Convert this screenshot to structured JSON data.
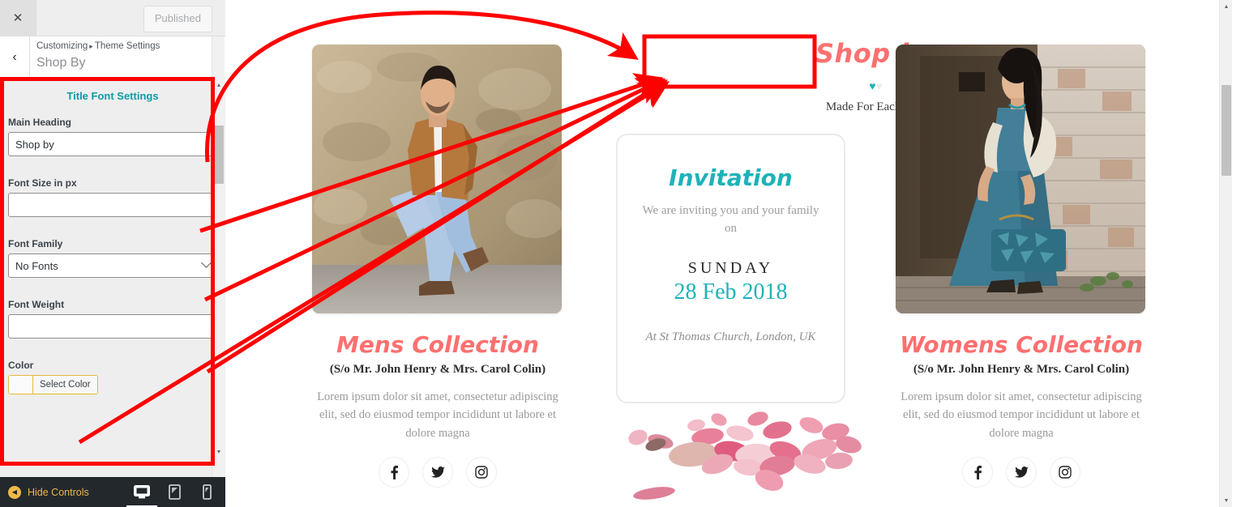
{
  "customizer": {
    "close_icon": "✕",
    "back_icon": "‹",
    "publish_button": "Published",
    "breadcrumb_root": "Customizing",
    "breadcrumb_sep": "▸",
    "breadcrumb_section": "Theme Settings",
    "panel_title": "Shop By",
    "section_title": "Title Font Settings",
    "fields": [
      {
        "label": "Main Heading",
        "value": "Shop by",
        "placeholder": "",
        "type": "text"
      },
      {
        "label": "Font Size in px",
        "value": "",
        "placeholder": "",
        "type": "text"
      },
      {
        "label": "Font Family",
        "value": "No Fonts",
        "placeholder": "",
        "type": "select"
      },
      {
        "label": "Font Weight",
        "value": "",
        "placeholder": "",
        "type": "text"
      },
      {
        "label": "Color",
        "value": "",
        "button_label": "Select Color",
        "swatch": "#ffffff",
        "type": "color"
      }
    ],
    "footer": {
      "hide_controls": "Hide Controls",
      "hide_icon": "◀",
      "devices": [
        {
          "name": "desktop",
          "active": true
        },
        {
          "name": "tablet",
          "active": false
        },
        {
          "name": "mobile",
          "active": false
        }
      ]
    },
    "scroll": {
      "up_arrow": "▲",
      "down_arrow": "▼"
    },
    "accent_color": "#0d9ba8",
    "footer_accent": "#f0b849"
  },
  "preview": {
    "shop_title": "Shop by",
    "heart_left": "♥",
    "heart_right": "♥",
    "tagline": "Made For Eachother",
    "columns": [
      {
        "photo_alt": "man-in-tan-blazer-photo",
        "title_bold": "Mens",
        "title_light": "Collection",
        "subtitle": "(S/o Mr. John Henry & Mrs. Carol Colin)",
        "description": "Lorem ipsum dolor sit amet, consectetur adipiscing elit, sed do eiusmod tempor incididunt ut labore et dolore magna",
        "social": [
          "facebook",
          "twitter",
          "instagram"
        ]
      },
      {
        "photo_alt": "woman-in-teal-dress-photo",
        "title_bold": "Womens",
        "title_light": "Collection",
        "subtitle": "(S/o Mr. John Henry & Mrs. Carol Colin)",
        "description": "Lorem ipsum dolor sit amet, consectetur adipiscing elit, sed do eiusmod tempor incididunt ut labore et dolore magna",
        "social": [
          "facebook",
          "twitter",
          "instagram"
        ]
      }
    ],
    "invitation": {
      "title": "Invitation",
      "lead": "We are inviting you and your family on",
      "day": "SUNDAY",
      "date": "28 Feb 2018",
      "venue": "At St Thomas Church, London, UK"
    },
    "petals_alt": "rose-petals-photo",
    "colors": {
      "title_coral": "#fd7070",
      "teal": "#1eb2b8",
      "muted": "#9a9a9a"
    },
    "scroll": {
      "up_arrow": "▲",
      "down_arrow": "▼"
    }
  },
  "annotations": {
    "highlight_color": "#ff0000",
    "boxes": [
      "title-font-settings-panel-box",
      "shop-by-heading-box"
    ],
    "arrow_count": 5
  }
}
